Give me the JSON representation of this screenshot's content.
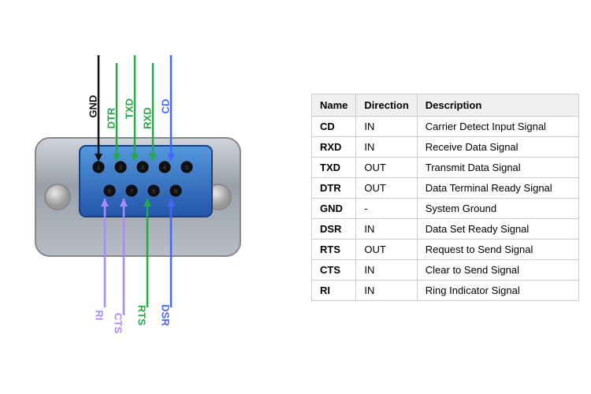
{
  "table": {
    "headers": [
      "Name",
      "Direction",
      "Description"
    ],
    "rows": [
      {
        "name": "CD",
        "dir": "IN",
        "desc": "Carrier Detect Input Signal"
      },
      {
        "name": "RXD",
        "dir": "IN",
        "desc": "Receive Data Signal"
      },
      {
        "name": "TXD",
        "dir": "OUT",
        "desc": "Transmit Data Signal"
      },
      {
        "name": "DTR",
        "dir": "OUT",
        "desc": "Data Terminal Ready Signal"
      },
      {
        "name": "GND",
        "dir": "-",
        "desc": "System Ground"
      },
      {
        "name": "DSR",
        "dir": "IN",
        "desc": "Data Set Ready Signal"
      },
      {
        "name": "RTS",
        "dir": "OUT",
        "desc": "Request to Send Signal"
      },
      {
        "name": "CTS",
        "dir": "IN",
        "desc": "Clear to Send Signal"
      },
      {
        "name": "RI",
        "dir": "IN",
        "desc": "Ring Indicator Signal"
      }
    ]
  },
  "signals": {
    "top": [
      {
        "name": "GND",
        "color": "#111111"
      },
      {
        "name": "DTR",
        "color": "#22aa44"
      },
      {
        "name": "TXD",
        "color": "#22aa44"
      },
      {
        "name": "RXD",
        "color": "#22aa44"
      },
      {
        "name": "CD",
        "color": "#4466ff"
      }
    ],
    "bottom": [
      {
        "name": "RI",
        "color": "#aa88ff"
      },
      {
        "name": "CTS",
        "color": "#aa88ff"
      },
      {
        "name": "RTS",
        "color": "#22aa44"
      },
      {
        "name": "DSR",
        "color": "#4466ff"
      }
    ]
  }
}
